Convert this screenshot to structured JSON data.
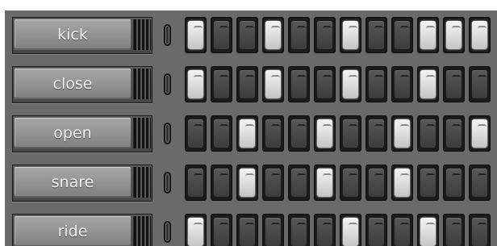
{
  "tracks": [
    {
      "label": "kick",
      "steps": [
        1,
        0,
        0,
        1,
        0,
        0,
        1,
        0,
        0,
        1,
        1,
        1
      ]
    },
    {
      "label": "close",
      "steps": [
        1,
        0,
        0,
        1,
        0,
        0,
        1,
        0,
        0,
        1,
        0,
        0
      ]
    },
    {
      "label": "open",
      "steps": [
        0,
        0,
        1,
        0,
        0,
        1,
        0,
        0,
        1,
        0,
        0,
        1
      ]
    },
    {
      "label": "snare",
      "steps": [
        0,
        0,
        1,
        0,
        0,
        1,
        0,
        0,
        1,
        0,
        0,
        0
      ]
    },
    {
      "label": "ride",
      "steps": [
        1,
        0,
        0,
        0,
        0,
        0,
        1,
        0,
        0,
        1,
        0,
        0
      ]
    }
  ]
}
